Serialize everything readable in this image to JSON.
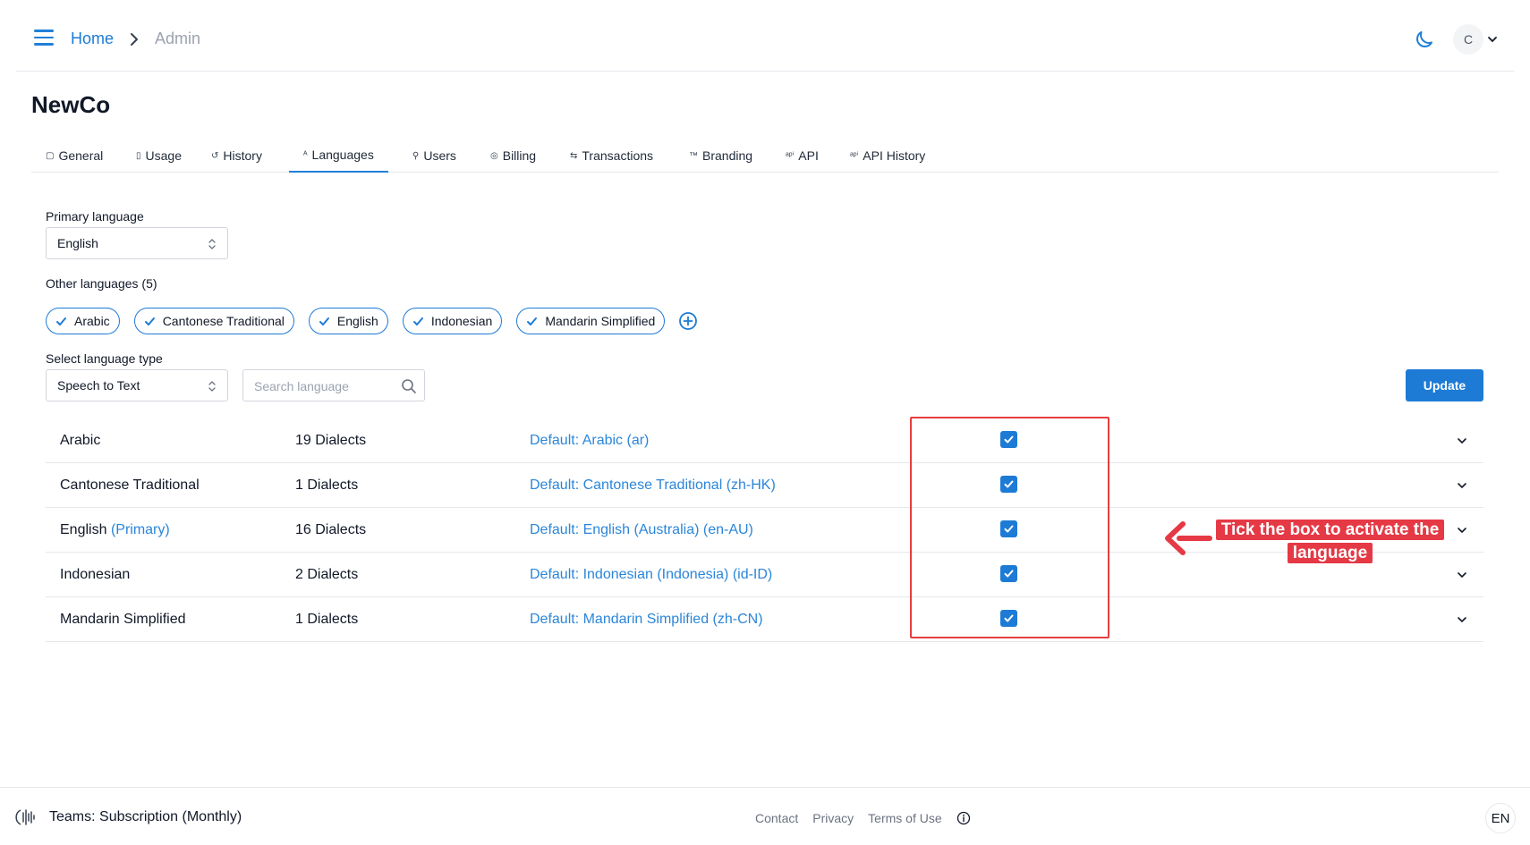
{
  "header": {
    "breadcrumb": {
      "home": "Home",
      "current": "Admin"
    },
    "avatar_initial": "C"
  },
  "org_title": "NewCo",
  "tabs": [
    {
      "label": "General",
      "icon": "▢"
    },
    {
      "label": "Usage",
      "icon": "▯"
    },
    {
      "label": "History",
      "icon": "↺"
    },
    {
      "label": "Languages",
      "icon": "ᴬ",
      "active": true
    },
    {
      "label": "Users",
      "icon": "⚲"
    },
    {
      "label": "Billing",
      "icon": "◎"
    },
    {
      "label": "Transactions",
      "icon": "⇆"
    },
    {
      "label": "Branding",
      "icon": "™"
    },
    {
      "label": "API",
      "icon": "ᵃᵖⁱ"
    },
    {
      "label": "API History",
      "icon": "ᵃᵖⁱ"
    }
  ],
  "primary_language": {
    "label": "Primary language",
    "value": "English"
  },
  "other_languages": {
    "label": "Other languages (5)",
    "chips": [
      "Arabic",
      "Cantonese Traditional",
      "English",
      "Indonesian",
      "Mandarin Simplified"
    ]
  },
  "language_type": {
    "label": "Select language type",
    "value": "Speech to Text"
  },
  "search": {
    "placeholder": "Search language"
  },
  "update_label": "Update",
  "languages": [
    {
      "name": "Arabic",
      "primary_tag": "",
      "dialects": "19 Dialects",
      "default": "Default: Arabic (ar)",
      "checked": true
    },
    {
      "name": "Cantonese Traditional",
      "primary_tag": "",
      "dialects": "1 Dialects",
      "default": "Default: Cantonese Traditional (zh-HK)",
      "checked": true
    },
    {
      "name": "English",
      "primary_tag": "(Primary)",
      "dialects": "16 Dialects",
      "default": "Default: English (Australia) (en-AU)",
      "checked": true
    },
    {
      "name": "Indonesian",
      "primary_tag": "",
      "dialects": "2 Dialects",
      "default": "Default: Indonesian (Indonesia) (id-ID)",
      "checked": true
    },
    {
      "name": "Mandarin Simplified",
      "primary_tag": "",
      "dialects": "1 Dialects",
      "default": "Default: Mandarin Simplified (zh-CN)",
      "checked": true
    }
  ],
  "annotation": {
    "text": "Tick the box to activate the language",
    "color": "#e53945"
  },
  "footer": {
    "plan": "Teams: Subscription (Monthly)",
    "links": [
      "Contact",
      "Privacy",
      "Terms of Use"
    ],
    "language": "EN"
  },
  "colors": {
    "accent": "#1d7bd6",
    "link": "#2b86d9",
    "annotation": "#e53e3e"
  },
  "icons": {
    "menu": "hamburger-menu-icon",
    "breadcrumb_sep": "chevron-right-icon",
    "theme": "moon-icon",
    "avatar_chevron": "chevron-down-icon",
    "select": "up-down-chevron-icon",
    "chip_check": "check-icon",
    "add": "plus-circle-icon",
    "search": "search-icon",
    "row_expand": "chevron-down-icon",
    "footer_logo": "app-logo-icon",
    "footer_info": "info-circle-icon",
    "annotation_arrow": "arrow-left-icon"
  }
}
